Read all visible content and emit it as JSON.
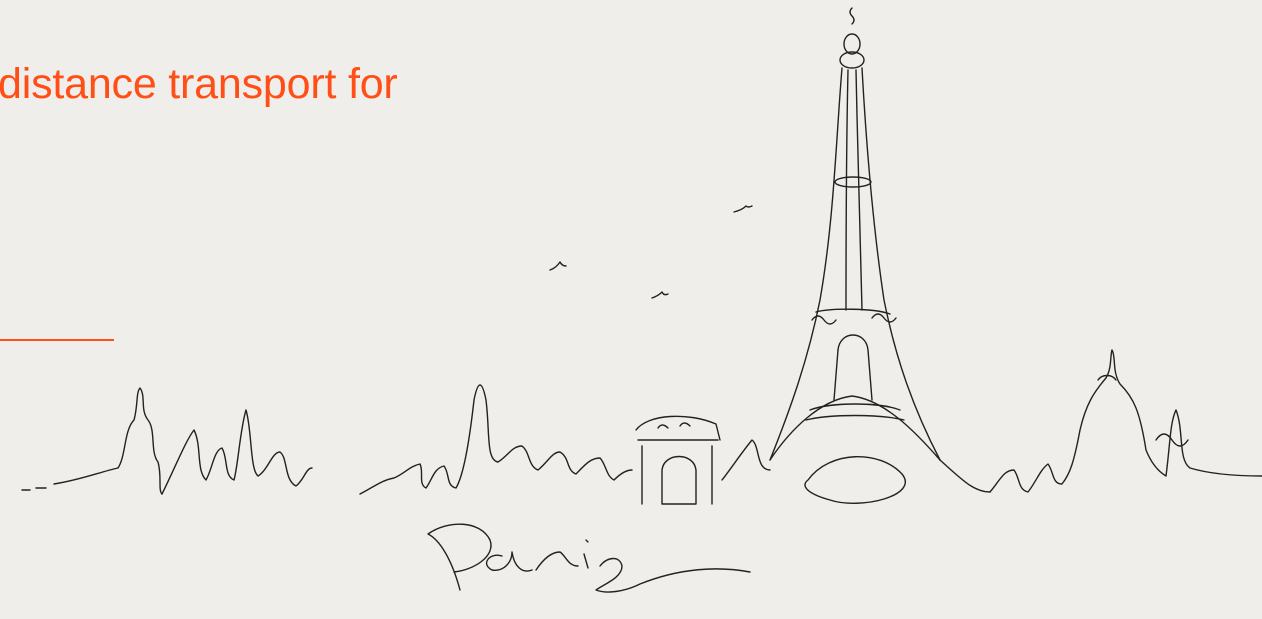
{
  "hero": {
    "headline": "distance transport for",
    "accent_color": "#ff4f17",
    "background_color": "#efeeea"
  },
  "illustration": {
    "icon": "paris-skyline-line-drawing",
    "signature_text": "Paris"
  }
}
